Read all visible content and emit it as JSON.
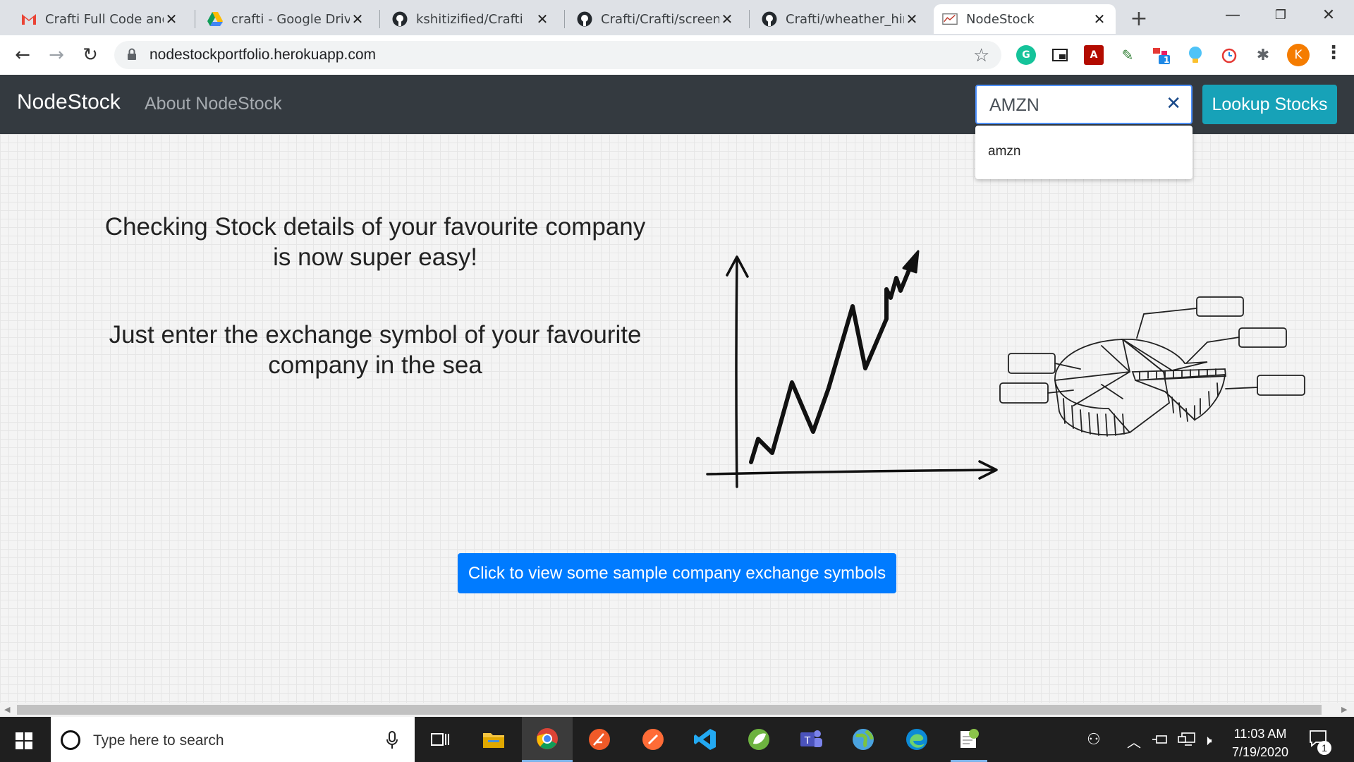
{
  "browser": {
    "tabs": [
      {
        "title": "Crafti Full Code and S",
        "icon": "gmail-icon"
      },
      {
        "title": "crafti - Google Drive",
        "icon": "google-drive-icon"
      },
      {
        "title": "kshitizified/Crafti",
        "icon": "github-icon"
      },
      {
        "title": "Crafti/Crafti/screensh",
        "icon": "github-icon"
      },
      {
        "title": "Crafti/wheather_hind",
        "icon": "github-icon"
      },
      {
        "title": "NodeStock",
        "icon": "nodestock-favicon"
      }
    ],
    "active_tab": 5,
    "new_tab": "+",
    "url": "nodestockportfolio.herokuapp.com",
    "profile_initial": "K"
  },
  "navbar": {
    "brand": "NodeStock",
    "about": "About NodeStock",
    "search_value": "AMZN",
    "clear": "✕",
    "lookup_button": "Lookup Stocks",
    "suggestion": "amzn"
  },
  "hero": {
    "line1": "Checking Stock details of your favourite company",
    "line2": "is now super easy!",
    "line3": "Just enter the exchange symbol of your favourite",
    "line4": "company in the sea"
  },
  "sample_button": "Click to view some sample company exchange symbols",
  "taskbar": {
    "search_placeholder": "Type here to search",
    "time": "11:03 AM",
    "date": "7/19/2020",
    "notification_count": "1",
    "extension_badge": "1"
  },
  "colors": {
    "navbar_bg": "#343a40",
    "lookup_button": "#17a2b8",
    "sample_button": "#007bff"
  }
}
